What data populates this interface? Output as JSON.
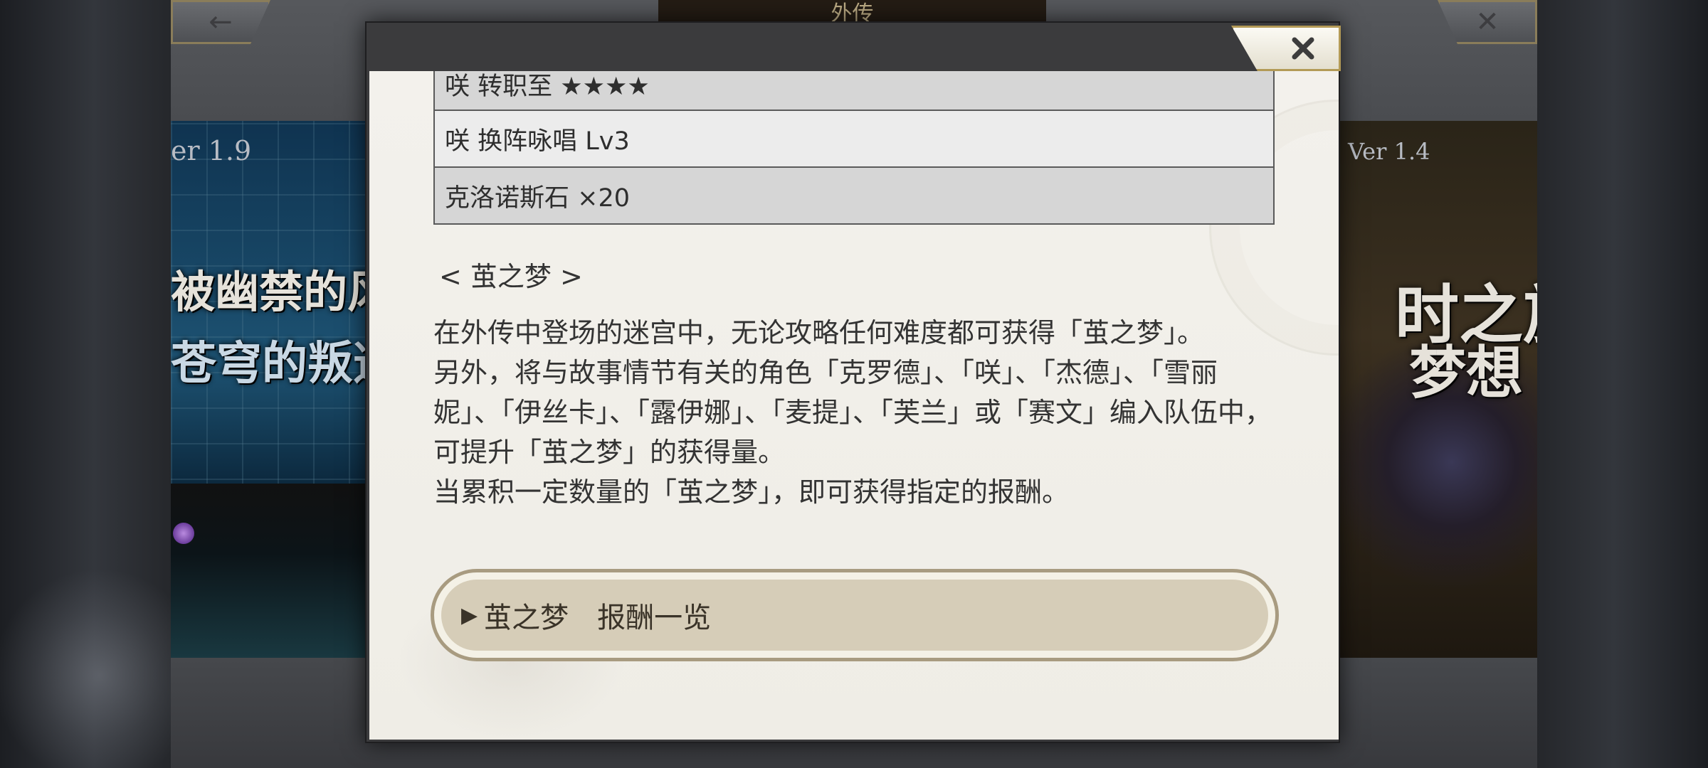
{
  "background": {
    "top_tab_label": "外传",
    "left_banner": {
      "version": "er 1.9",
      "title_line1": "被幽禁的风",
      "title_line2": "苍穹的叛逆"
    },
    "right_banner": {
      "version": "Ver 1.4",
      "title_line1": "时之旅",
      "title_line2": "梦想"
    },
    "back_icon": "arrow-left-icon",
    "close_icon": "close-icon"
  },
  "modal": {
    "close_icon": "close-icon",
    "reward_rows": [
      "咲 转职至 ★★★★",
      "咲 换阵咏唱 Lv3",
      "克洛诺斯石 ×20"
    ],
    "section_heading": "< 茧之梦 >",
    "description": [
      "在外传中登场的迷宫中，无论攻略任何难度都可获得「茧之梦」。",
      "另外，将与故事情节有关的角色「克罗德」、「咲」、「杰德」、「雪丽妮」、「伊丝卡」、「露伊娜」、「麦提」、「芙兰」或「赛文」编入队伍中，可提升「茧之梦」的获得量。",
      "当累积一定数量的「茧之梦」，即可获得指定的报酬。"
    ],
    "rewards_button_label": "茧之梦　报酬一览",
    "rewards_button_icon": "play-icon"
  },
  "colors": {
    "panel_bg": "#f3f1ec",
    "button_fill": "#d6cdb8",
    "button_border": "#a89b80",
    "close_border": "#b39a56"
  }
}
